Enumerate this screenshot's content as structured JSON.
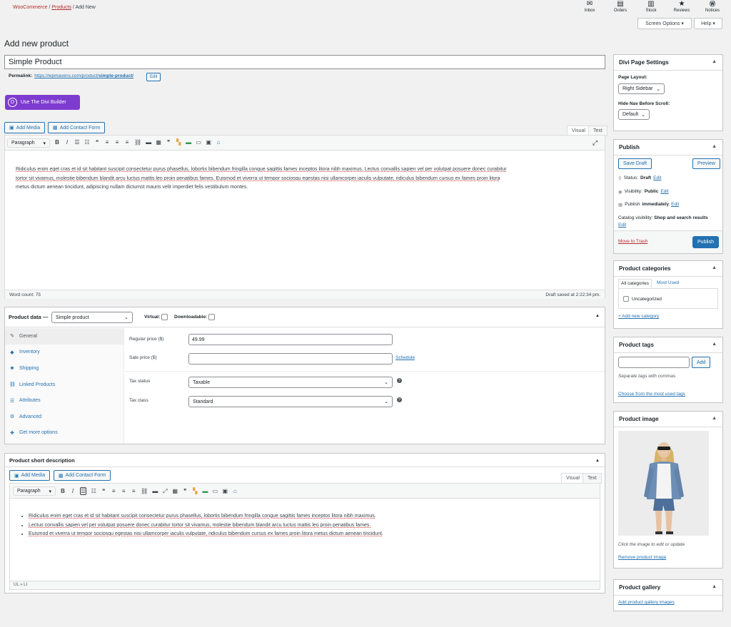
{
  "breadcrumb": {
    "woocommerce": "WooCommerce",
    "products": "Products",
    "current": "Add New"
  },
  "topnav": [
    {
      "label": "Inbox",
      "icon": "inbox-icon"
    },
    {
      "label": "Orders",
      "icon": "orders-icon"
    },
    {
      "label": "Stock",
      "icon": "stock-icon"
    },
    {
      "label": "Reviews",
      "icon": "reviews-icon"
    },
    {
      "label": "Notices",
      "icon": "wordpress-icon"
    }
  ],
  "screen_options": "Screen Options ▾",
  "help": "Help ▾",
  "page_title": "Add new product",
  "title_value": "Simple Product",
  "permalink": {
    "label": "Permalink:",
    "url_prefix": "https://wpmavens.com/product/",
    "slug": "simple-product/",
    "edit": "Edit"
  },
  "divi_button": "Use The Divi Builder",
  "editor": {
    "add_media": "Add Media",
    "add_contact_form": "Add Contact Form",
    "tab_visual": "Visual",
    "tab_text": "Text",
    "format": "Paragraph",
    "content_line1": "Ridiculus enim eget cras et id sit habitant suscipit consectetur purus phasellus, lobortis bibendum fringilla congue sagittis fames inceptos litora nibh maximus. Lectus convallis sapien vel per volutpat posuere donec curabitur",
    "content_line2": "tortor sit vivamus, molestie bibendum blandit arcu luctus mattis leo proin penatibus fames. Euismod et viverra ut tempor sociosqu egestas nisi ullamcorper iaculis vulputate, ridiculus bibendum cursus ex fames proin litora",
    "content_line3": "metus dictum aenean tincidunt, adipiscing nullam dictumst mauris velit imperdiet felis vestibulum montes.",
    "word_count": "Word count: 75",
    "draft_saved": "Draft saved at 2:22:34 pm."
  },
  "product_data": {
    "label": "Product data —",
    "type": "Simple product",
    "virtual": "Virtual:",
    "downloadable": "Downloadable:",
    "tabs": [
      {
        "label": "General",
        "icon": "wrench-icon"
      },
      {
        "label": "Inventory",
        "icon": "inventory-icon"
      },
      {
        "label": "Shipping",
        "icon": "truck-icon"
      },
      {
        "label": "Linked Products",
        "icon": "link-icon"
      },
      {
        "label": "Attributes",
        "icon": "list-icon"
      },
      {
        "label": "Advanced",
        "icon": "gear-icon"
      },
      {
        "label": "Get more options",
        "icon": "plugin-icon"
      }
    ],
    "regular_price_label": "Regular price ($)",
    "regular_price": "49.99",
    "sale_price_label": "Sale price ($)",
    "sale_price": "",
    "schedule": "Schedule",
    "tax_status_label": "Tax status",
    "tax_status": "Taxable",
    "tax_class_label": "Tax class",
    "tax_class": "Standard"
  },
  "short_desc": {
    "title": "Product short description",
    "add_media": "Add Media",
    "add_contact_form": "Add Contact Form",
    "tab_visual": "Visual",
    "tab_text": "Text",
    "format": "Paragraph",
    "items": [
      "Ridiculus enim eget cras et id sit habitant suscipit consectetur purus phasellus, lobortis bibendum fringilla congue sagittis fames inceptos litora nibh maximus.",
      "Lectus convallis sapien vel per volutpat posuere donec curabitur tortor sit vivamus, molestie bibendum blandit arcu luctus mattis leo proin penatibus fames.",
      "Euismod et viverra ut tempor sociosqu egestas nisi ullamcorper iaculis vulputate, ridiculus bibendum cursus ex fames proin litora metus dictum aenean tincidunt."
    ],
    "path": "UL » LI"
  },
  "divi_settings": {
    "title": "Divi Page Settings",
    "layout_label": "Page Layout:",
    "layout_value": "Right Sidebar",
    "hide_nav_label": "Hide Nav Before Scroll:",
    "hide_nav_value": "Default"
  },
  "publish": {
    "title": "Publish",
    "save_draft": "Save Draft",
    "preview": "Preview",
    "status_label": "Status:",
    "status_value": "Draft",
    "visibility_label": "Visibility:",
    "visibility_value": "Public",
    "publish_label": "Publish",
    "publish_value": "immediately",
    "catalog_label": "Catalog visibility:",
    "catalog_value": "Shop and search results",
    "edit": "Edit",
    "trash": "Move to Trash",
    "publish_button": "Publish"
  },
  "categories": {
    "title": "Product categories",
    "tab_all": "All categories",
    "tab_used": "Most Used",
    "item": "Uncategorized",
    "add": "+ Add new category"
  },
  "tags": {
    "title": "Product tags",
    "add": "Add",
    "hint": "Separate tags with commas",
    "choose": "Choose from the most used tags"
  },
  "product_image": {
    "title": "Product image",
    "hint": "Click the image to edit or update",
    "remove": "Remove product image"
  },
  "gallery": {
    "title": "Product gallery",
    "add": "Add product gallery images"
  },
  "colors": {
    "accent": "#2271b1",
    "divi": "#7e3bd0",
    "publish": "#2271b1",
    "trash": "#b32d2e"
  }
}
